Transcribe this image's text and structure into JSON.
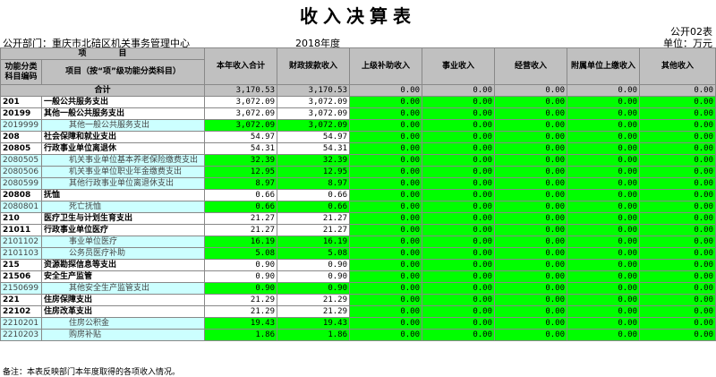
{
  "title": "收入决算表",
  "form_no": "公开02表",
  "department": "公开部门：重庆市北碚区机关事务管理中心",
  "year": "2018年度",
  "unit": "单位：万元",
  "headers": {
    "item": "项　　　　目",
    "code": "功能分类科目编码",
    "name": "项目（按“项”级功能分类科目）",
    "cols": [
      "本年收入合计",
      "财政拨款收入",
      "上级补助收入",
      "事业收入",
      "经营收入",
      "附属单位上缴收入",
      "其他收入"
    ]
  },
  "total": {
    "label": "合计",
    "values": [
      "3,170.53",
      "3,170.53",
      "0.00",
      "0.00",
      "0.00",
      "0.00",
      "0.00"
    ]
  },
  "rows": [
    {
      "code": "201",
      "name": "一般公共服务支出",
      "level": "bold",
      "values": [
        "3,072.09",
        "3,072.09",
        "0.00",
        "0.00",
        "0.00",
        "0.00",
        "0.00"
      ]
    },
    {
      "code": "20199",
      "name": "其他一般公共服务支出",
      "level": "bold",
      "values": [
        "3,072.09",
        "3,072.09",
        "0.00",
        "0.00",
        "0.00",
        "0.00",
        "0.00"
      ]
    },
    {
      "code": "2019999",
      "name": "其他一般公共服务支出",
      "level": "light",
      "values": [
        "3,072.09",
        "3,072.09",
        "0.00",
        "0.00",
        "0.00",
        "0.00",
        "0.00"
      ]
    },
    {
      "code": "208",
      "name": "社会保障和就业支出",
      "level": "bold",
      "values": [
        "54.97",
        "54.97",
        "0.00",
        "0.00",
        "0.00",
        "0.00",
        "0.00"
      ]
    },
    {
      "code": "20805",
      "name": "行政事业单位离退休",
      "level": "bold",
      "values": [
        "54.31",
        "54.31",
        "0.00",
        "0.00",
        "0.00",
        "0.00",
        "0.00"
      ]
    },
    {
      "code": "2080505",
      "name": "机关事业单位基本养老保险缴费支出",
      "level": "light",
      "values": [
        "32.39",
        "32.39",
        "0.00",
        "0.00",
        "0.00",
        "0.00",
        "0.00"
      ]
    },
    {
      "code": "2080506",
      "name": "机关事业单位职业年金缴费支出",
      "level": "light",
      "values": [
        "12.95",
        "12.95",
        "0.00",
        "0.00",
        "0.00",
        "0.00",
        "0.00"
      ]
    },
    {
      "code": "2080599",
      "name": "其他行政事业单位离退休支出",
      "level": "light",
      "values": [
        "8.97",
        "8.97",
        "0.00",
        "0.00",
        "0.00",
        "0.00",
        "0.00"
      ]
    },
    {
      "code": "20808",
      "name": "抚恤",
      "level": "bold",
      "values": [
        "0.66",
        "0.66",
        "0.00",
        "0.00",
        "0.00",
        "0.00",
        "0.00"
      ]
    },
    {
      "code": "2080801",
      "name": "死亡抚恤",
      "level": "light",
      "values": [
        "0.66",
        "0.66",
        "0.00",
        "0.00",
        "0.00",
        "0.00",
        "0.00"
      ]
    },
    {
      "code": "210",
      "name": "医疗卫生与计划生育支出",
      "level": "bold",
      "values": [
        "21.27",
        "21.27",
        "0.00",
        "0.00",
        "0.00",
        "0.00",
        "0.00"
      ]
    },
    {
      "code": "21011",
      "name": "行政事业单位医疗",
      "level": "bold",
      "values": [
        "21.27",
        "21.27",
        "0.00",
        "0.00",
        "0.00",
        "0.00",
        "0.00"
      ]
    },
    {
      "code": "2101102",
      "name": "事业单位医疗",
      "level": "light",
      "values": [
        "16.19",
        "16.19",
        "0.00",
        "0.00",
        "0.00",
        "0.00",
        "0.00"
      ]
    },
    {
      "code": "2101103",
      "name": "公务员医疗补助",
      "level": "light",
      "values": [
        "5.08",
        "5.08",
        "0.00",
        "0.00",
        "0.00",
        "0.00",
        "0.00"
      ]
    },
    {
      "code": "215",
      "name": "资源勘探信息等支出",
      "level": "bold",
      "values": [
        "0.90",
        "0.90",
        "0.00",
        "0.00",
        "0.00",
        "0.00",
        "0.00"
      ]
    },
    {
      "code": "21506",
      "name": "安全生产监管",
      "level": "bold",
      "values": [
        "0.90",
        "0.90",
        "0.00",
        "0.00",
        "0.00",
        "0.00",
        "0.00"
      ]
    },
    {
      "code": "2150699",
      "name": "其他安全生产监管支出",
      "level": "light",
      "values": [
        "0.90",
        "0.90",
        "0.00",
        "0.00",
        "0.00",
        "0.00",
        "0.00"
      ]
    },
    {
      "code": "221",
      "name": "住房保障支出",
      "level": "bold",
      "values": [
        "21.29",
        "21.29",
        "0.00",
        "0.00",
        "0.00",
        "0.00",
        "0.00"
      ]
    },
    {
      "code": "22102",
      "name": "住房改革支出",
      "level": "bold",
      "values": [
        "21.29",
        "21.29",
        "0.00",
        "0.00",
        "0.00",
        "0.00",
        "0.00"
      ]
    },
    {
      "code": "2210201",
      "name": "住房公积金",
      "level": "light",
      "values": [
        "19.43",
        "19.43",
        "0.00",
        "0.00",
        "0.00",
        "0.00",
        "0.00"
      ]
    },
    {
      "code": "2210203",
      "name": "购房补贴",
      "level": "light",
      "values": [
        "1.86",
        "1.86",
        "0.00",
        "0.00",
        "0.00",
        "0.00",
        "0.00"
      ]
    }
  ],
  "note": "备注：本表反映部门本年度取得的各项收入情况。"
}
